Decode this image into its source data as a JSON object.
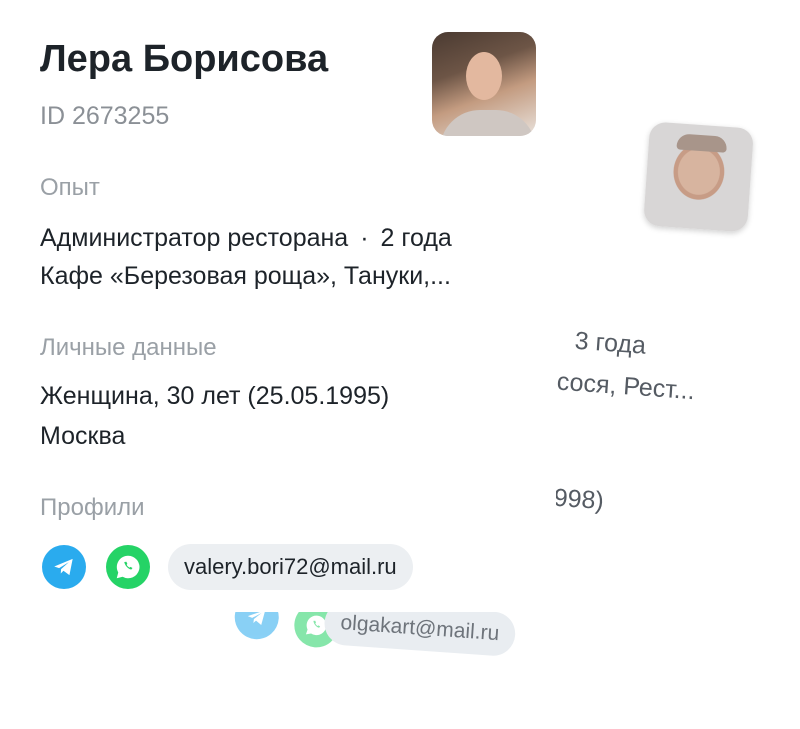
{
  "primary": {
    "name": "Лера Борисова",
    "id_text": "ID 2673255",
    "experience": {
      "label": "Опыт",
      "position": "Администратор ресторана",
      "separator": "·",
      "duration": "2 года",
      "places": "Кафе «Березовая роща», Тануки,..."
    },
    "personal": {
      "label": "Личные данные",
      "gender_age": "Женщина, 30 лет (25.05.1995)",
      "city": "Москва"
    },
    "profiles": {
      "label": "Профили",
      "icons": [
        "telegram-icon",
        "whatsapp-icon"
      ],
      "email": "valery.bori72@mail.ru"
    }
  },
  "secondary": {
    "duration": "3 года",
    "places": "сося, Рест...",
    "birth_fragment": "998)",
    "icons": [
      "telegram-icon",
      "whatsapp-icon"
    ],
    "email": "olgakart@mail.ru"
  },
  "colors": {
    "telegram": "#2AABEE",
    "whatsapp": "#25D366",
    "text_primary": "#1d2329",
    "text_secondary": "#9aa0a6",
    "pill_bg": "#eceff2"
  }
}
